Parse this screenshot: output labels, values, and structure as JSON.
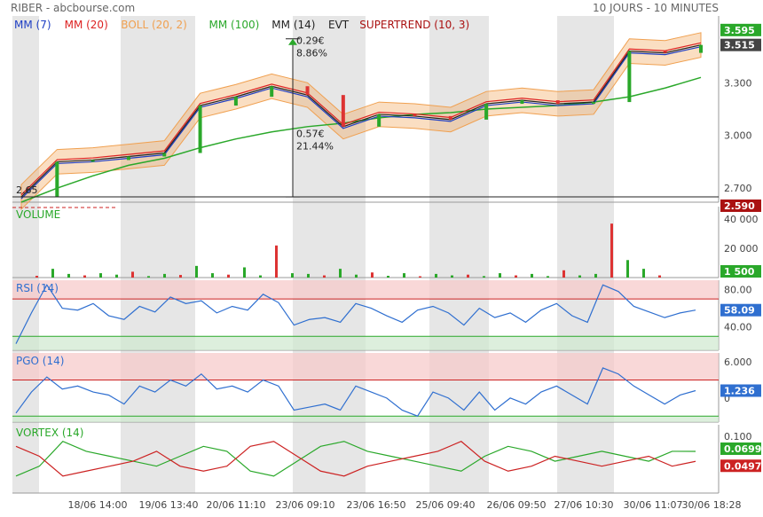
{
  "header": {
    "title": "RIBER - abcbourse.com",
    "range": "10 JOURS - 10 MINUTES"
  },
  "colors": {
    "mm7": "#1f3fc4",
    "mm20": "#dd2222",
    "boll": "#f0a050",
    "mm100": "#2aa82a",
    "mm14": "#222222",
    "evt": "#222222",
    "supertrend": "#aa1111",
    "rsi": "#2f6fd0",
    "pgo": "#2f6fd0",
    "vortex_plus": "#2aa82a",
    "vortex_minus": "#cc2222",
    "up_volume": "#2aa82a",
    "down_volume": "#dd3333"
  },
  "chart_data": [
    {
      "type": "line",
      "panel": "price",
      "title": "RIBER",
      "legend": [
        {
          "label": "MM (7)",
          "color": "#1f3fc4"
        },
        {
          "label": "MM (20)",
          "color": "#dd2222"
        },
        {
          "label": "BOLL (20, 2)",
          "color": "#f0a050"
        },
        {
          "label": "MM (100)",
          "color": "#2aa82a"
        },
        {
          "label": "MM (14)",
          "color": "#222222"
        },
        {
          "label": "EVT",
          "color": "#222222"
        },
        {
          "label": "SUPERTREND (10, 3)",
          "color": "#aa1111"
        }
      ],
      "x_ticks": [
        "18/06 14:00",
        "19/06 13:40",
        "20/06 11:10",
        "23/06 09:10",
        "23/06 16:50",
        "25/06 09:40",
        "26/06 09:50",
        "27/06 10:30",
        "30/06 11:07",
        "30/06 18:28"
      ],
      "y_ticks": [
        "3.595",
        "3.300",
        "3.000",
        "2.700"
      ],
      "ylim": [
        2.62,
        3.68
      ],
      "last_price": "3.515",
      "high_label": "3.595",
      "low_label": "2.590",
      "start_label": "2.65",
      "annotations": [
        {
          "text": "0.29€",
          "text2": "8.86%"
        },
        {
          "text": "0.57€",
          "text2": "21.44%"
        }
      ],
      "x": [
        0,
        0.5,
        1.0,
        1.5,
        2.0,
        2.5,
        3.0,
        3.5,
        4.0,
        4.5,
        5.0,
        5.5,
        6.0,
        6.5,
        7.0,
        7.5,
        8.0,
        8.5,
        9.0,
        9.5
      ],
      "close": [
        2.65,
        2.85,
        2.86,
        2.88,
        2.9,
        3.17,
        3.22,
        3.28,
        3.23,
        3.05,
        3.12,
        3.11,
        3.09,
        3.18,
        3.2,
        3.18,
        3.19,
        3.48,
        3.47,
        3.515
      ],
      "mm100": [
        2.62,
        2.7,
        2.77,
        2.83,
        2.87,
        2.93,
        2.98,
        3.02,
        3.05,
        3.07,
        3.1,
        3.12,
        3.13,
        3.15,
        3.16,
        3.17,
        3.19,
        3.22,
        3.27,
        3.33
      ]
    },
    {
      "type": "bar",
      "panel": "volume",
      "title": "VOLUME",
      "y_ticks": [
        "40 000",
        "20 000"
      ],
      "last_value": "1 500",
      "peak_value": 37000,
      "values": [
        1200,
        6000,
        2500,
        1500,
        3000,
        2000,
        4000,
        1000,
        2500,
        1800,
        8000,
        3000,
        2000,
        7000,
        1500,
        22000,
        3000,
        2500,
        1500,
        6000,
        2000,
        3500,
        1200,
        3000,
        900,
        2500,
        1500,
        2000,
        1000,
        3000,
        1500,
        2500,
        1000,
        5000,
        1500,
        2500,
        37000,
        12000,
        6000,
        1500
      ]
    },
    {
      "type": "line",
      "panel": "rsi",
      "title": "RSI (14)",
      "y_ticks": [
        "80.00",
        "40.00"
      ],
      "ylim": [
        15,
        90
      ],
      "last_value": "58.09",
      "overbought": 70,
      "oversold": 30,
      "values": [
        22,
        55,
        85,
        60,
        58,
        65,
        52,
        48,
        62,
        56,
        72,
        65,
        68,
        55,
        62,
        58,
        75,
        66,
        42,
        48,
        50,
        45,
        65,
        60,
        52,
        45,
        58,
        62,
        55,
        42,
        60,
        50,
        55,
        45,
        58,
        65,
        52,
        45,
        85,
        78,
        62,
        56,
        50,
        55,
        58
      ]
    },
    {
      "type": "line",
      "panel": "pgo",
      "title": "PGO (14)",
      "y_ticks": [
        "6.000",
        "0"
      ],
      "ylim": [
        -4,
        7.5
      ],
      "last_value": "1.236",
      "overbought": 3,
      "oversold": -3,
      "values": [
        -2.5,
        1,
        3.5,
        1.5,
        2,
        1,
        0.5,
        -1,
        2,
        1,
        3,
        2,
        4,
        1.5,
        2,
        1,
        3,
        2,
        -2,
        -1.5,
        -1,
        -2,
        2,
        1,
        0,
        -2,
        -3,
        1,
        0,
        -2,
        1,
        -2,
        0,
        -1,
        1,
        2,
        0.5,
        -1,
        5,
        4,
        2,
        0.5,
        -1,
        0.5,
        1.236
      ]
    },
    {
      "type": "line",
      "panel": "vortex",
      "title": "VORTEX (14)",
      "y_ticks": [
        "0.100"
      ],
      "last_values": [
        "0.0699",
        "0.0497"
      ],
      "series": [
        {
          "values": [
            0.02,
            0.04,
            0.09,
            0.07,
            0.06,
            0.05,
            0.04,
            0.06,
            0.08,
            0.07,
            0.03,
            0.02,
            0.05,
            0.08,
            0.09,
            0.07,
            0.06,
            0.05,
            0.04,
            0.03,
            0.06,
            0.08,
            0.07,
            0.05,
            0.06,
            0.07,
            0.06,
            0.05,
            0.07,
            0.0699
          ]
        },
        {
          "values": [
            0.08,
            0.06,
            0.02,
            0.03,
            0.04,
            0.05,
            0.07,
            0.04,
            0.03,
            0.04,
            0.08,
            0.09,
            0.06,
            0.03,
            0.02,
            0.04,
            0.05,
            0.06,
            0.07,
            0.09,
            0.05,
            0.03,
            0.04,
            0.06,
            0.05,
            0.04,
            0.05,
            0.06,
            0.04,
            0.0497
          ]
        }
      ]
    }
  ]
}
